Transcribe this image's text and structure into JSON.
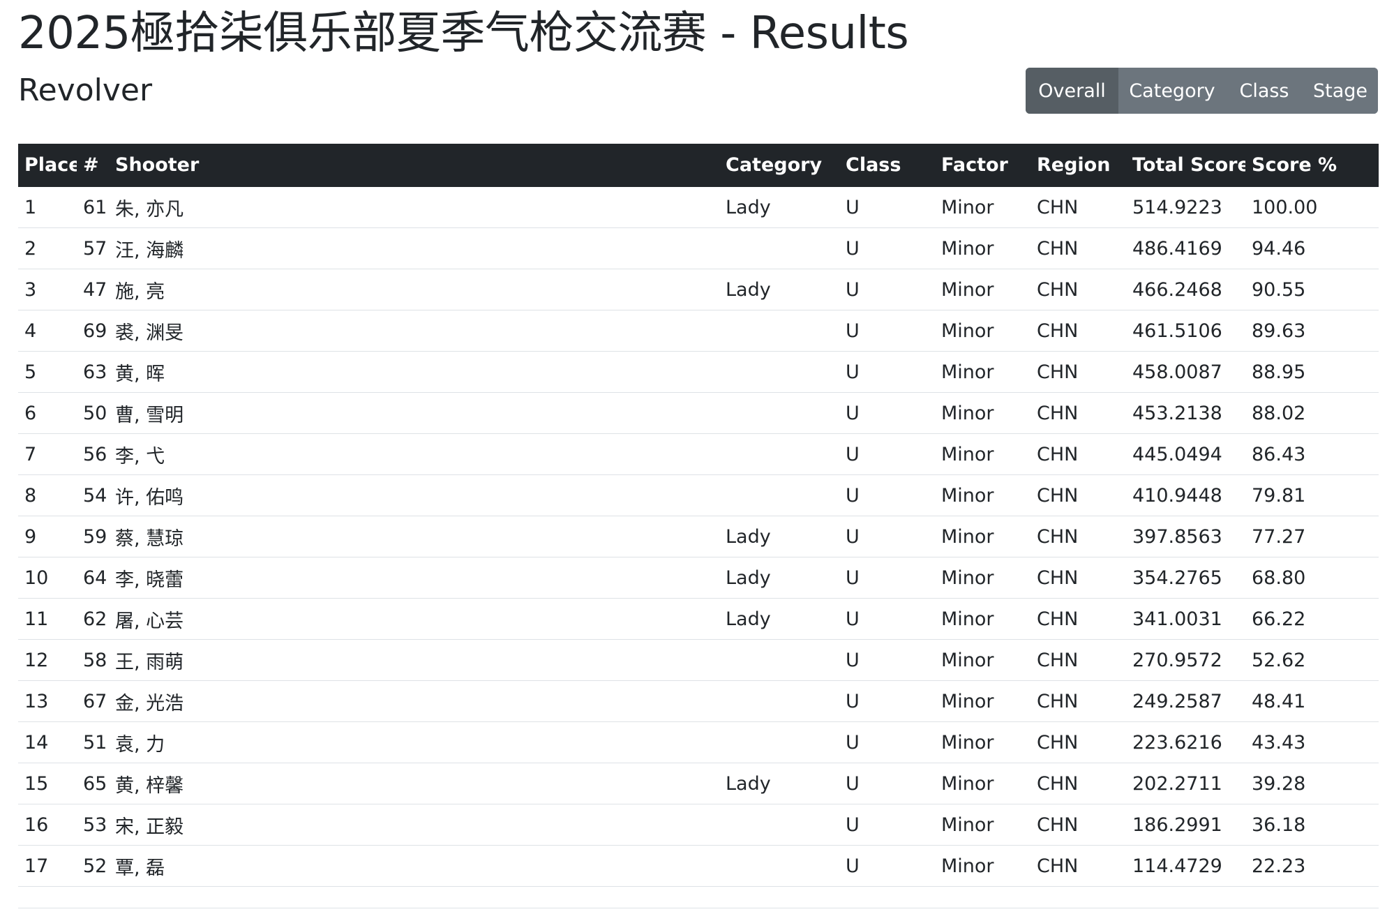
{
  "header": {
    "title": "2025極拾柒俱乐部夏季气枪交流赛 - Results",
    "subtitle": "Revolver"
  },
  "view_tabs": [
    {
      "label": "Overall",
      "active": true
    },
    {
      "label": "Category",
      "active": false
    },
    {
      "label": "Class",
      "active": false
    },
    {
      "label": "Stage",
      "active": false
    }
  ],
  "table": {
    "columns": [
      "Place",
      "#",
      "Shooter",
      "Category",
      "Class",
      "Factor",
      "Region",
      "Total Score",
      "Score %"
    ],
    "rows": [
      [
        "1",
        "61",
        "朱, 亦凡",
        "Lady",
        "U",
        "Minor",
        "CHN",
        "514.9223",
        "100.00"
      ],
      [
        "2",
        "57",
        "汪, 海麟",
        "",
        "U",
        "Minor",
        "CHN",
        "486.4169",
        "94.46"
      ],
      [
        "3",
        "47",
        "施, 亮",
        "Lady",
        "U",
        "Minor",
        "CHN",
        "466.2468",
        "90.55"
      ],
      [
        "4",
        "69",
        "裘, 渊旻",
        "",
        "U",
        "Minor",
        "CHN",
        "461.5106",
        "89.63"
      ],
      [
        "5",
        "63",
        "黄, 晖",
        "",
        "U",
        "Minor",
        "CHN",
        "458.0087",
        "88.95"
      ],
      [
        "6",
        "50",
        "曹, 雪明",
        "",
        "U",
        "Minor",
        "CHN",
        "453.2138",
        "88.02"
      ],
      [
        "7",
        "56",
        "李, 弋",
        "",
        "U",
        "Minor",
        "CHN",
        "445.0494",
        "86.43"
      ],
      [
        "8",
        "54",
        "许, 佑鸣",
        "",
        "U",
        "Minor",
        "CHN",
        "410.9448",
        "79.81"
      ],
      [
        "9",
        "59",
        "蔡, 慧琼",
        "Lady",
        "U",
        "Minor",
        "CHN",
        "397.8563",
        "77.27"
      ],
      [
        "10",
        "64",
        "李, 晓蕾",
        "Lady",
        "U",
        "Minor",
        "CHN",
        "354.2765",
        "68.80"
      ],
      [
        "11",
        "62",
        "屠, 心芸",
        "Lady",
        "U",
        "Minor",
        "CHN",
        "341.0031",
        "66.22"
      ],
      [
        "12",
        "58",
        "王, 雨萌",
        "",
        "U",
        "Minor",
        "CHN",
        "270.9572",
        "52.62"
      ],
      [
        "13",
        "67",
        "金, 光浩",
        "",
        "U",
        "Minor",
        "CHN",
        "249.2587",
        "48.41"
      ],
      [
        "14",
        "51",
        "袁, 力",
        "",
        "U",
        "Minor",
        "CHN",
        "223.6216",
        "43.43"
      ],
      [
        "15",
        "65",
        "黄, 梓馨",
        "Lady",
        "U",
        "Minor",
        "CHN",
        "202.2711",
        "39.28"
      ],
      [
        "16",
        "53",
        "宋, 正毅",
        "",
        "U",
        "Minor",
        "CHN",
        "186.2991",
        "36.18"
      ],
      [
        "17",
        "52",
        "覃, 磊",
        "",
        "U",
        "Minor",
        "CHN",
        "114.4729",
        "22.23"
      ]
    ]
  }
}
